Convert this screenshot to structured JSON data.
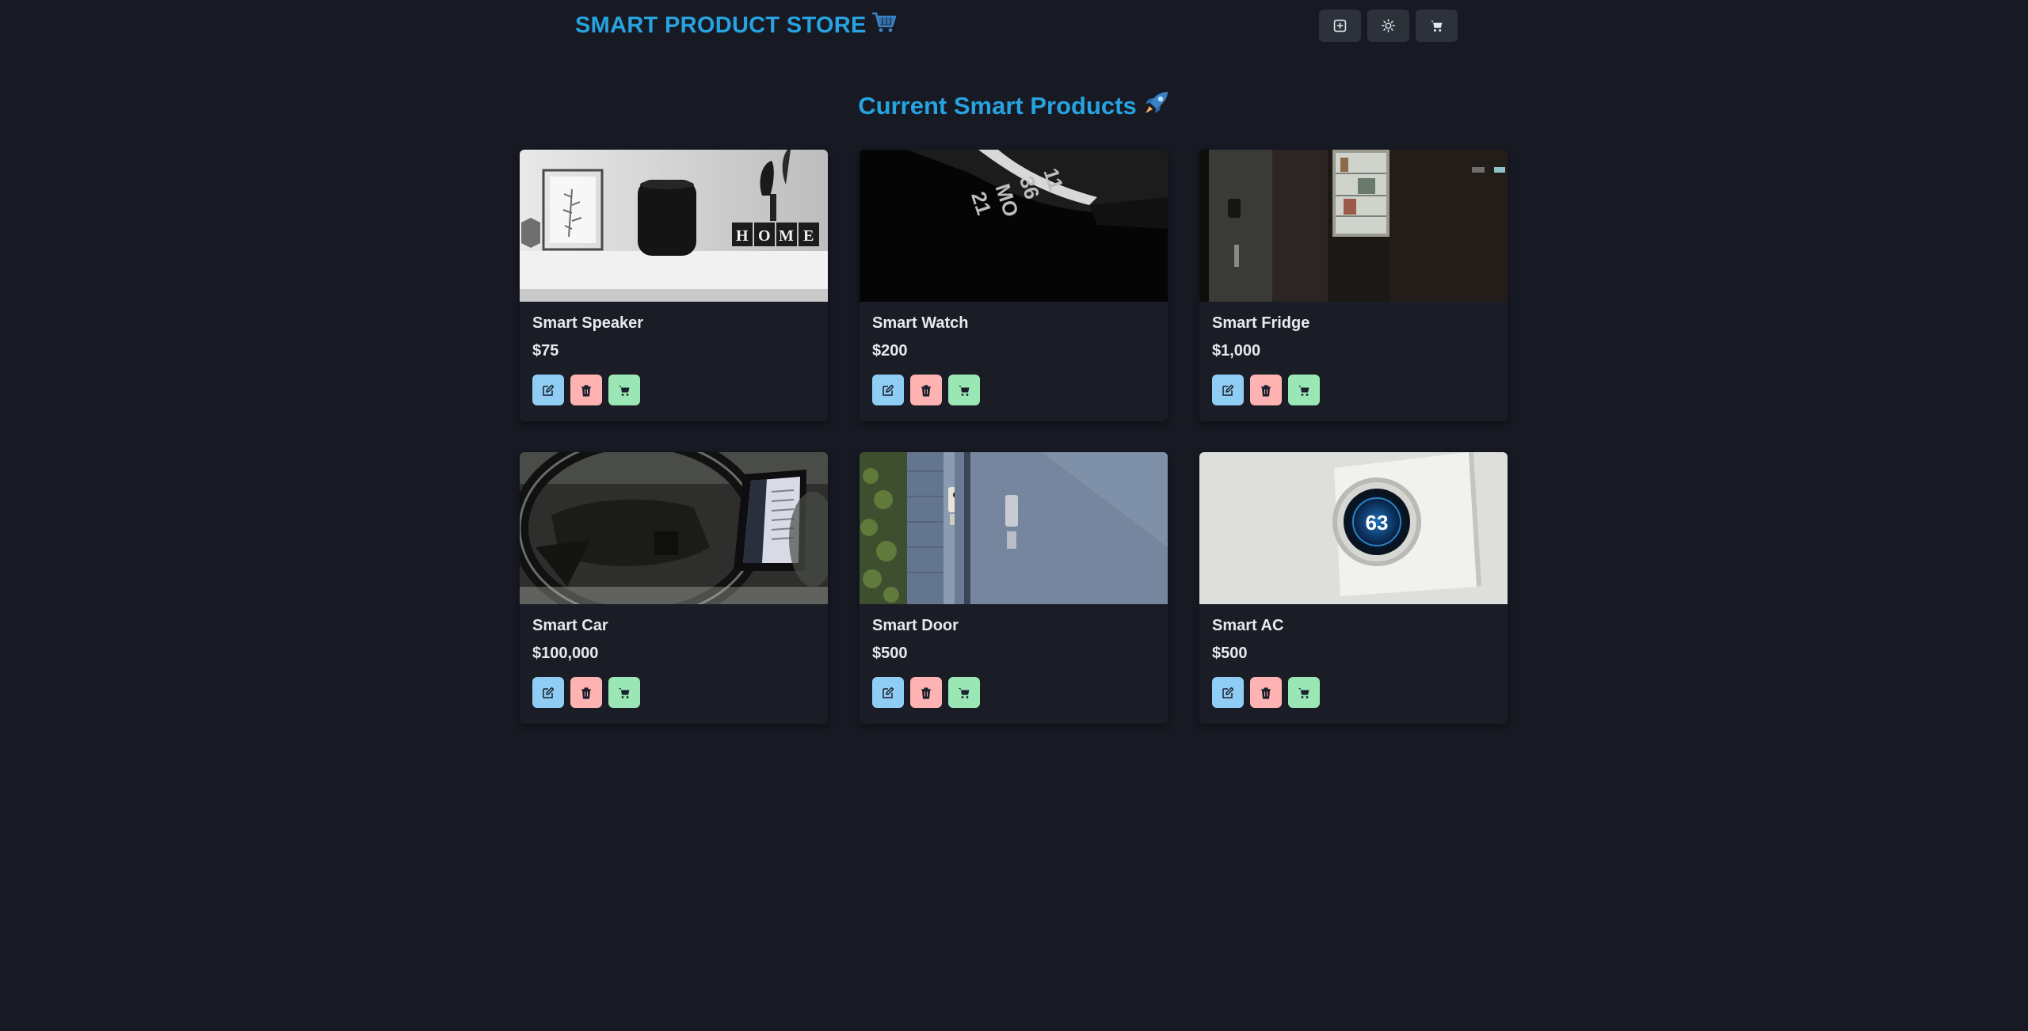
{
  "header": {
    "brand": "SMART PRODUCT STORE",
    "brand_icon": "shopping-cart-emoji",
    "actions": [
      {
        "icon": "plus-square-icon",
        "name": "create-product-button"
      },
      {
        "icon": "sun-icon",
        "name": "theme-toggle-button"
      },
      {
        "icon": "cart-icon",
        "name": "cart-button"
      }
    ]
  },
  "main": {
    "title": "Current Smart Products",
    "title_icon": "rocket-emoji"
  },
  "products": [
    {
      "name": "Smart Speaker",
      "price": "$75"
    },
    {
      "name": "Smart Watch",
      "price": "$200"
    },
    {
      "name": "Smart Fridge",
      "price": "$1,000"
    },
    {
      "name": "Smart Car",
      "price": "$100,000"
    },
    {
      "name": "Smart Door",
      "price": "$500"
    },
    {
      "name": "Smart AC",
      "price": "$500"
    }
  ],
  "thermostat_reading": "63",
  "watch_face_digits": [
    "11",
    "36",
    "MO",
    "21"
  ],
  "decor_letters": [
    "H",
    "O",
    "M",
    "E"
  ],
  "colors": {
    "background": "#171923",
    "accent": "#26a3e0",
    "edit": "#90cdf4",
    "delete": "#feb2b2",
    "cart": "#9ae6b4"
  }
}
